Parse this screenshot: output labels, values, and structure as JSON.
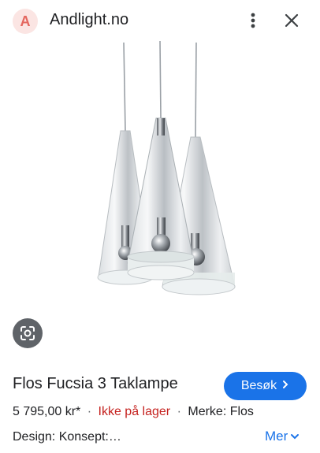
{
  "header": {
    "site_logo_letter": "A",
    "site_name": "Andlight.no",
    "more_icon": "more-vert-icon",
    "close_icon": "close-icon"
  },
  "image": {
    "subject": "lamp-photo",
    "lens_icon": "google-lens-icon"
  },
  "product": {
    "title": "Flos Fucsia 3 Taklampe",
    "visit_label": "Besøk",
    "price": "5 795,00 kr*",
    "separator": "·",
    "stock": "Ikke på lager",
    "brand": "Merke: Flos",
    "description": "Design: Konsept:…",
    "more_label": "Mer"
  },
  "colors": {
    "accent": "#1a73e8",
    "stock_red": "#c5221f",
    "logo_bg": "#fbe5e3",
    "logo_fg": "#e4665e"
  }
}
